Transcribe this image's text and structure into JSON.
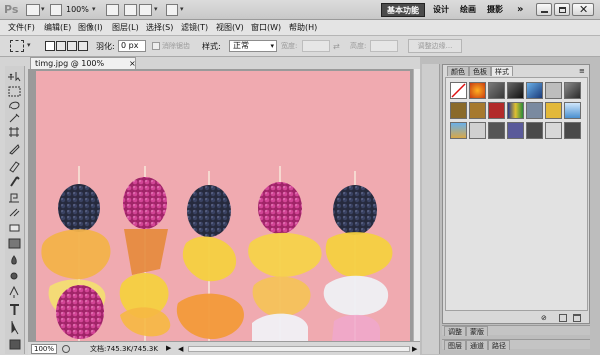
{
  "appbar": {
    "logo": "Ps",
    "zoom": "100%",
    "workspaces": [
      "基本功能",
      "设计",
      "绘画",
      "摄影"
    ],
    "more": "»"
  },
  "menu": [
    "文件(F)",
    "编辑(E)",
    "图像(I)",
    "图层(L)",
    "选择(S)",
    "滤镜(T)",
    "视图(V)",
    "窗口(W)",
    "帮助(H)"
  ],
  "options": {
    "feather_label": "羽化:",
    "feather_value": "0 px",
    "antialias_label": "消除锯齿",
    "style_label": "样式:",
    "style_value": "正常",
    "width_label": "宽度:",
    "height_label": "高度:",
    "refine_button": "调整边缘..."
  },
  "document": {
    "tab_title": "timg.jpg @ 100%(RGB/8#)",
    "close": "×",
    "zoom": "100%",
    "doc_size": "文档:745.3K/745.3K"
  },
  "panel": {
    "tabs": [
      "颜色",
      "色板",
      "样式"
    ],
    "active_tab": "样式",
    "dock_tabs_1": [
      "调整",
      "蒙版"
    ],
    "dock_tabs_2": [
      "图层",
      "通道",
      "路径"
    ]
  },
  "colors": {
    "canvas_bg": "#f0aab0",
    "blackberry": "#2b3148",
    "raspberry": "#c23a86",
    "gummy_yellow": "#f4d040",
    "gummy_orange": "#f2b24a",
    "gummy_white": "#eef0f4"
  }
}
